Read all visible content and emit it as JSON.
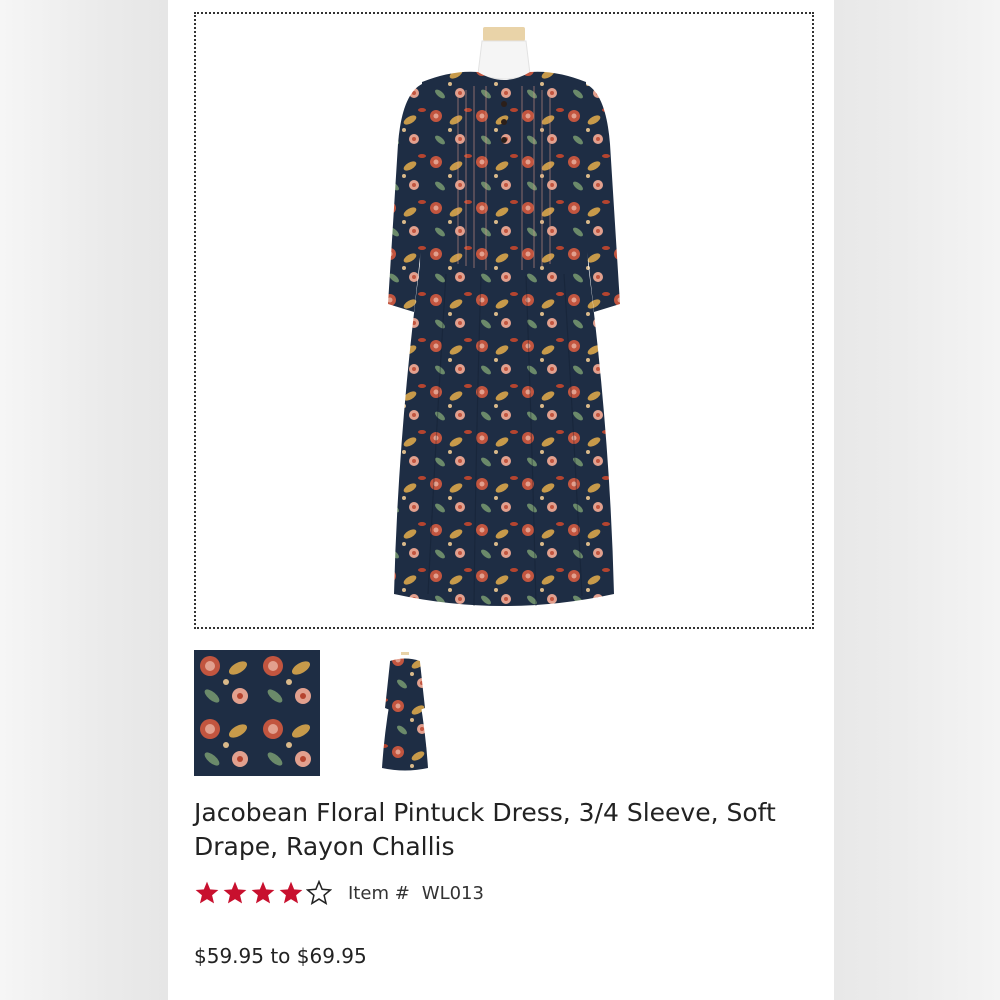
{
  "product": {
    "title": "Jacobean Floral Pintuck Dress, 3/4 Sleeve, Soft Drape, Rayon Challis",
    "rating": 4,
    "rating_max": 5,
    "item_label": "Item #",
    "item_number": "WL013",
    "price": "$59.95 to $69.95"
  },
  "colors": {
    "star": "#c8102e",
    "dress_base": "#1e2d44",
    "print_red": "#c2553f",
    "print_pink": "#e2a08e",
    "print_gold": "#c79a4a",
    "print_green": "#6b8a6a"
  },
  "icons": {
    "star_filled": "star-filled-icon",
    "star_empty": "star-empty-icon"
  }
}
